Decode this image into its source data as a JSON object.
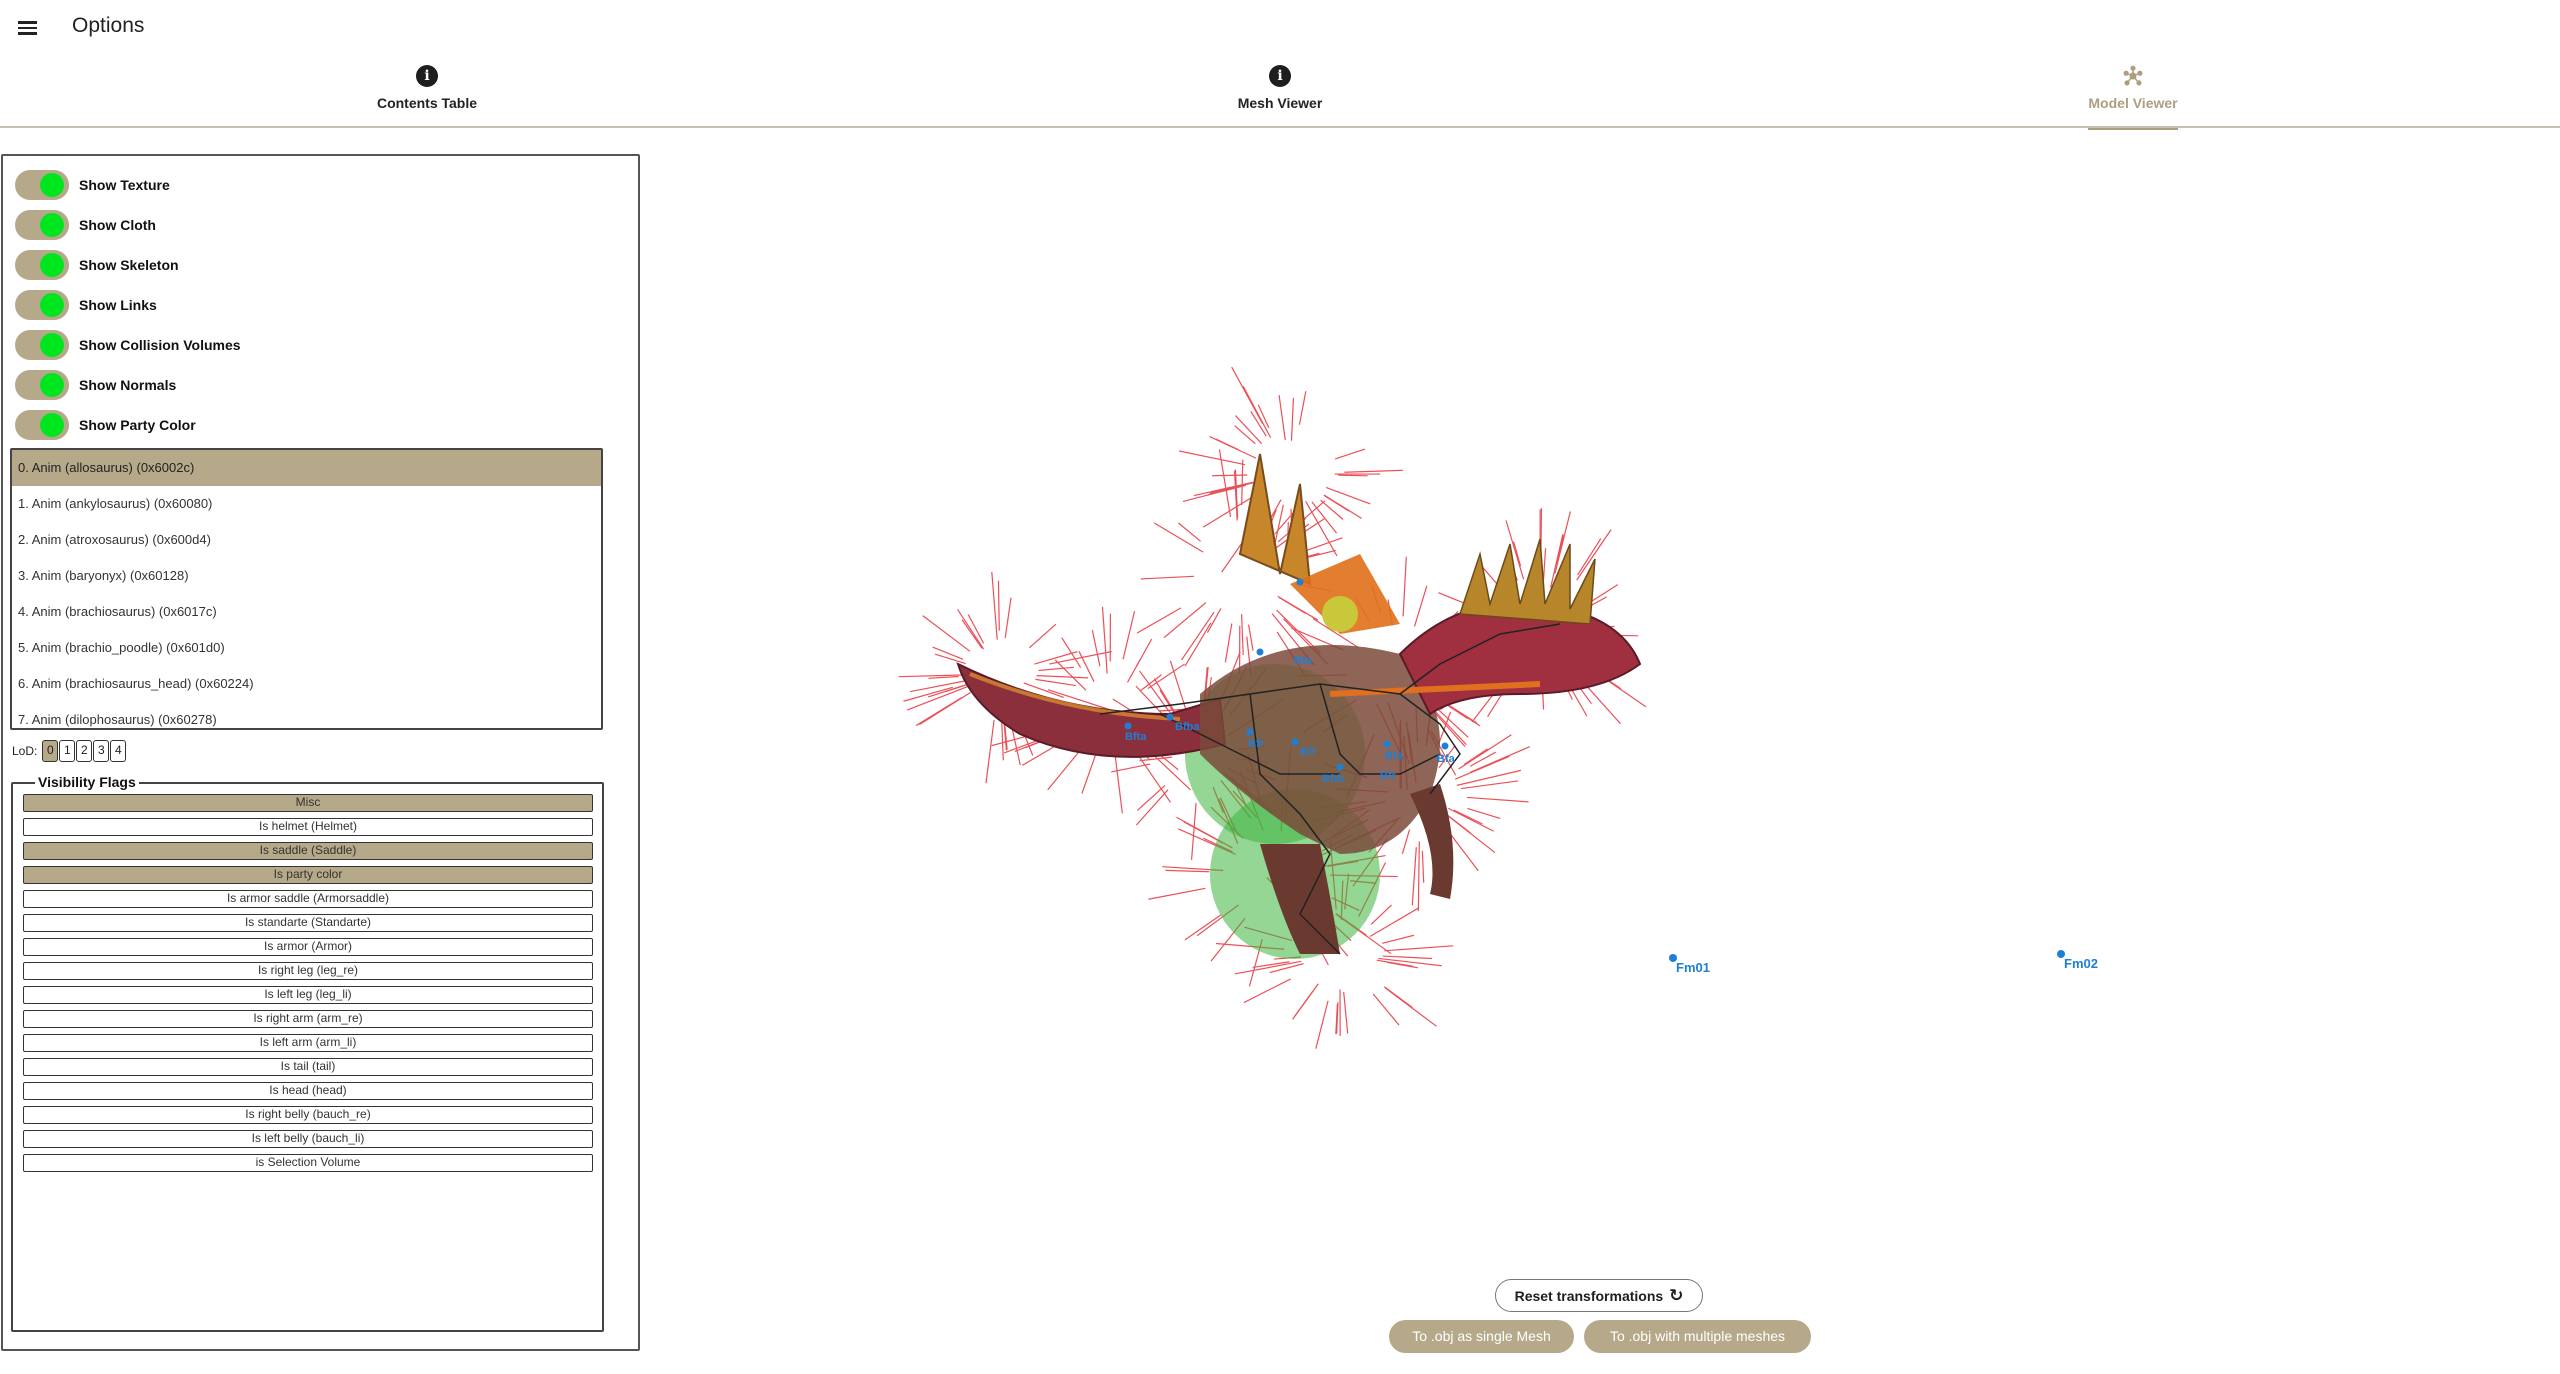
{
  "app": {
    "title": "Options",
    "menu_icon": "hamburger-menu-icon"
  },
  "tabs": [
    {
      "label": "Contents Table",
      "icon": "info-icon",
      "active": false
    },
    {
      "label": "Mesh Viewer",
      "icon": "info-icon",
      "active": false
    },
    {
      "label": "Model Viewer",
      "icon": "molecule-icon",
      "active": true
    }
  ],
  "toggles": [
    {
      "label": "Show Texture",
      "on": true
    },
    {
      "label": "Show Cloth",
      "on": true
    },
    {
      "label": "Show Skeleton",
      "on": true
    },
    {
      "label": "Show Links",
      "on": true
    },
    {
      "label": "Show Collision Volumes",
      "on": true
    },
    {
      "label": "Show Normals",
      "on": true
    },
    {
      "label": "Show Party Color",
      "on": true
    }
  ],
  "animations": {
    "selected_index": 0,
    "items": [
      "0. Anim (allosaurus) (0x6002c)",
      "1. Anim (ankylosaurus) (0x60080)",
      "2. Anim (atroxosaurus) (0x600d4)",
      "3. Anim (baryonyx) (0x60128)",
      "4. Anim (brachiosaurus) (0x6017c)",
      "5. Anim (brachio_poodle) (0x601d0)",
      "6. Anim (brachiosaurus_head) (0x60224)",
      "7. Anim (dilophosaurus) (0x60278)"
    ]
  },
  "lod": {
    "label": "LoD:",
    "levels": [
      "0",
      "1",
      "2",
      "3",
      "4"
    ],
    "selected": "0"
  },
  "visibility_flags": {
    "legend": "Visibility Flags",
    "items": [
      {
        "label": "Misc",
        "on": true
      },
      {
        "label": "Is helmet (Helmet)",
        "on": false
      },
      {
        "label": "Is saddle (Saddle)",
        "on": true
      },
      {
        "label": "Is party color",
        "on": true
      },
      {
        "label": "Is armor saddle (Armorsaddle)",
        "on": false
      },
      {
        "label": "Is standarte (Standarte)",
        "on": false
      },
      {
        "label": "Is armor (Armor)",
        "on": false
      },
      {
        "label": "Is right leg (leg_re)",
        "on": false
      },
      {
        "label": "Is left leg (leg_li)",
        "on": false
      },
      {
        "label": "Is right arm (arm_re)",
        "on": false
      },
      {
        "label": "Is left arm (arm_li)",
        "on": false
      },
      {
        "label": "Is tail (tail)",
        "on": false
      },
      {
        "label": "Is head (head)",
        "on": false
      },
      {
        "label": "Is right belly (bauch_re)",
        "on": false
      },
      {
        "label": "Is left belly (bauch_li)",
        "on": false
      },
      {
        "label": "is Selection Volume",
        "on": false
      }
    ]
  },
  "viewer": {
    "bone_labels": [
      "Bfta",
      "Bfba",
      "Bfr",
      "Bfr",
      "Bfth",
      "Bfr",
      "Bfa",
      "Bfa",
      "Bfa",
      "Fm01",
      "Fm02"
    ],
    "reset_label": "Reset transformations",
    "reset_icon": "refresh-icon",
    "export_single_label": "To .obj as single Mesh",
    "export_multi_label": "To .obj with multiple meshes"
  },
  "colors": {
    "accent": "#b6a98a",
    "toggle_knob": "#00e61e",
    "bone_label": "#1e7fd6",
    "normals": "#e8323c",
    "collision_volume": "#3cb43c"
  }
}
